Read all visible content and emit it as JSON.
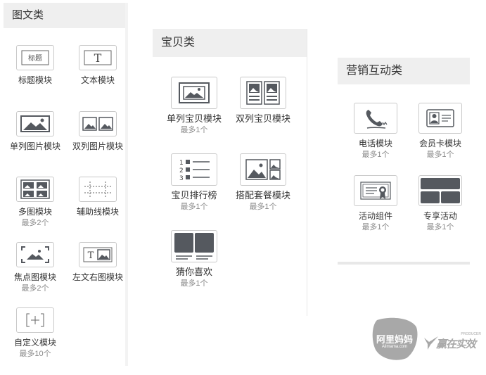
{
  "panels": {
    "tuwen": {
      "title": "图文类",
      "modules": [
        {
          "label": "标题模块",
          "icon": "title-icon",
          "icon_text": "标题"
        },
        {
          "label": "文本模块",
          "icon": "text-icon",
          "icon_text": "T"
        },
        {
          "label": "单列图片模块",
          "icon": "single-image-icon"
        },
        {
          "label": "双列图片模块",
          "icon": "double-image-icon"
        },
        {
          "label": "多图模块",
          "limit": "最多2个",
          "icon": "multi-image-icon"
        },
        {
          "label": "辅助线模块",
          "icon": "guide-line-icon"
        },
        {
          "label": "焦点图模块",
          "limit": "最多2个",
          "icon": "focus-image-icon"
        },
        {
          "label": "左文右图模块",
          "icon": "text-left-image-right-icon",
          "icon_text": "T"
        },
        {
          "label": "自定义模块",
          "limit": "最多10个",
          "icon": "custom-icon"
        }
      ]
    },
    "baobei": {
      "title": "宝贝类",
      "modules": [
        {
          "label": "单列宝贝模块",
          "limit": "最多1个",
          "icon": "single-item-icon"
        },
        {
          "label": "双列宝贝模块",
          "icon": "double-item-icon"
        },
        {
          "label": "宝贝排行榜",
          "limit": "最多1个",
          "icon": "ranking-list-icon",
          "icon_text": [
            "1",
            "2",
            "3"
          ]
        },
        {
          "label": "搭配套餐模块",
          "limit": "最多1个",
          "icon": "combo-package-icon"
        },
        {
          "label": "猜你喜欢",
          "limit": "最多1个",
          "icon": "guess-you-like-icon"
        }
      ]
    },
    "yingxiao": {
      "title": "营销互动类",
      "modules": [
        {
          "label": "电话模块",
          "limit": "最多1个",
          "icon": "phone-icon"
        },
        {
          "label": "会员卡模块",
          "limit": "最多1个",
          "icon": "member-card-icon"
        },
        {
          "label": "活动组件",
          "limit": "最多1个",
          "icon": "activity-certificate-icon"
        },
        {
          "label": "专享活动",
          "limit": "最多1个",
          "icon": "exclusive-activity-icon"
        }
      ]
    }
  },
  "watermark": {
    "alimama_text": "阿里妈妈",
    "alimama_sub": "Alimama.com",
    "slogan": "赢在实效",
    "slogan_sub": "PRODUCER"
  },
  "colors": {
    "header_bg": "#efefef",
    "icon_fill": "#55595f",
    "icon_border": "#c9c9c9",
    "watermark_gray": "#a8a8a8"
  }
}
